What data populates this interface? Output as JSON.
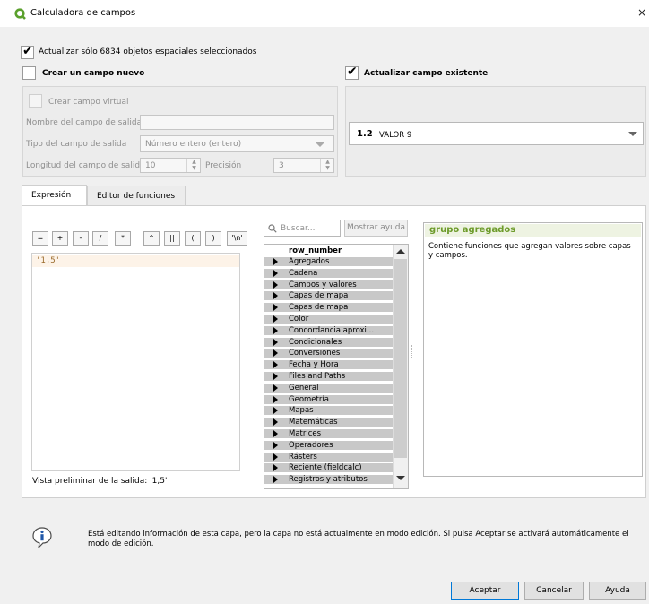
{
  "window": {
    "title": "Calculadora de campos",
    "close_glyph": "×"
  },
  "selection": {
    "update_selected_label": "Actualizar sólo 6834 objetos espaciales seleccionados",
    "update_selected_checked": true
  },
  "new_field": {
    "label": "Crear un campo nuevo",
    "checked": false,
    "virtual_field_label": "Crear campo virtual",
    "output_name_label": "Nombre del campo de salida",
    "output_name_value": "",
    "output_type_label": "Tipo del campo de salida",
    "output_type_value": "Número entero (entero)",
    "length_label": "Longitud del campo de salida",
    "length_value": "10",
    "precision_label": "Precisión",
    "precision_value": "3"
  },
  "existing_field": {
    "label": "Actualizar campo existente",
    "checked": true,
    "selected_prefix": "1.2",
    "selected_value": "VALOR 9"
  },
  "tabs": [
    {
      "label": "Expresión",
      "active": true
    },
    {
      "label": "Editor de funciones",
      "active": false
    }
  ],
  "operators": [
    "=",
    "+",
    "-",
    "/",
    "*",
    "^",
    "||",
    "(",
    ")",
    "'\\n'"
  ],
  "expression": {
    "value": "'1,5'",
    "preview_label": "Vista preliminar de la salida:",
    "preview_value": "'1,5'"
  },
  "search": {
    "placeholder": "Buscar...",
    "show_help_label": "Mostrar ayuda"
  },
  "function_tree": {
    "first_item": "row_number",
    "groups": [
      "Agregados",
      "Cadena",
      "Campos y valores",
      "Capas de mapa",
      "Capas de mapa",
      "Color",
      "Concordancia aproxi...",
      "Condicionales",
      "Conversiones",
      "Fecha y Hora",
      "Files and Paths",
      "General",
      "Geometría",
      "Mapas",
      "Matemáticas",
      "Matrices",
      "Operadores",
      "Rásters",
      "Reciente (fieldcalc)",
      "Registros y atributos"
    ]
  },
  "help": {
    "title": "grupo agregados",
    "body": "Contiene funciones que agregan valores sobre capas y campos."
  },
  "info": {
    "message": "Está editando información de esta capa, pero la capa no está actualmente en modo edición. Si pulsa Aceptar se activará automáticamente el modo de edición."
  },
  "buttons": {
    "ok": "Aceptar",
    "cancel": "Cancelar",
    "help": "Ayuda"
  },
  "colors": {
    "help_title": "#6d9b2a",
    "help_title_bg": "#eef3e2",
    "expression_string": "#9b6b2c",
    "tree_bg": "#c8c8c8",
    "qgis_green": "#5aa02c"
  }
}
